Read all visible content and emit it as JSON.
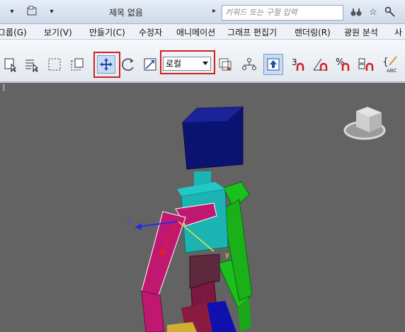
{
  "titlebar": {
    "title": "제목 없음",
    "search_placeholder": "키워드 또는 구절 입력"
  },
  "menu": [
    {
      "label": "그룹(G)"
    },
    {
      "label": "보기(V)"
    },
    {
      "label": "만들기(C)"
    },
    {
      "label": "수정자"
    },
    {
      "label": "애니메이션"
    },
    {
      "label": "그래프 편집기"
    },
    {
      "label": "렌더링(R)"
    },
    {
      "label": "광원 분석"
    },
    {
      "label": "사"
    }
  ],
  "toolbar": {
    "coordinate_system": "로컬",
    "snap_3_label": "3",
    "percent_label": "%",
    "abc_label": "ABC"
  },
  "viewport": {
    "bracket_label": "]",
    "axis_z_label": "z",
    "axis_y_label": "y"
  },
  "colors": {
    "highlight": "#d02020",
    "viewport_bg": "#636363",
    "head": "#0c1470",
    "torso": "#1cb3b3",
    "limb_magenta": "#c01870",
    "limb_green": "#1cc01c"
  }
}
